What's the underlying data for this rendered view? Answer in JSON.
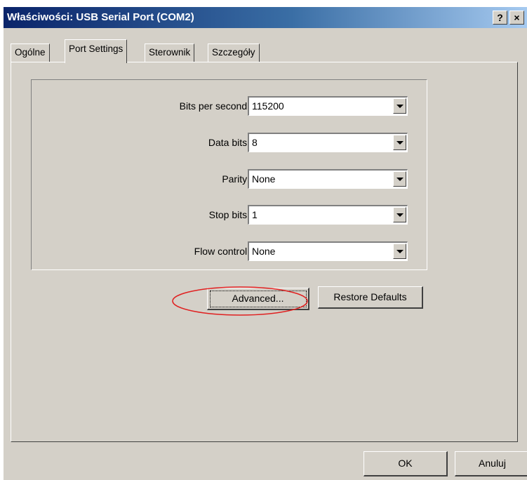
{
  "window": {
    "title": "Właściwości: USB Serial Port (COM2)",
    "help_button": "?",
    "close_button": "×"
  },
  "tabs": [
    {
      "label": "Ogólne",
      "active": false
    },
    {
      "label": "Port Settings",
      "active": true
    },
    {
      "label": "Sterownik",
      "active": false
    },
    {
      "label": "Szczegóły",
      "active": false
    }
  ],
  "settings": {
    "bits_per_second": {
      "label": "Bits per second:",
      "value": "115200"
    },
    "data_bits": {
      "label": "Data bits:",
      "value": "8"
    },
    "parity": {
      "label": "Parity:",
      "value": "None"
    },
    "stop_bits": {
      "label": "Stop bits:",
      "value": "1"
    },
    "flow_control": {
      "label": "Flow control:",
      "value": "None"
    }
  },
  "buttons": {
    "advanced": "Advanced...",
    "restore_defaults": "Restore Defaults",
    "ok": "OK",
    "cancel": "Anuluj"
  },
  "colors": {
    "face": "#d4d0c8",
    "title_start": "#0a246a",
    "title_end": "#a6caf0",
    "annotation": "#e02020"
  }
}
